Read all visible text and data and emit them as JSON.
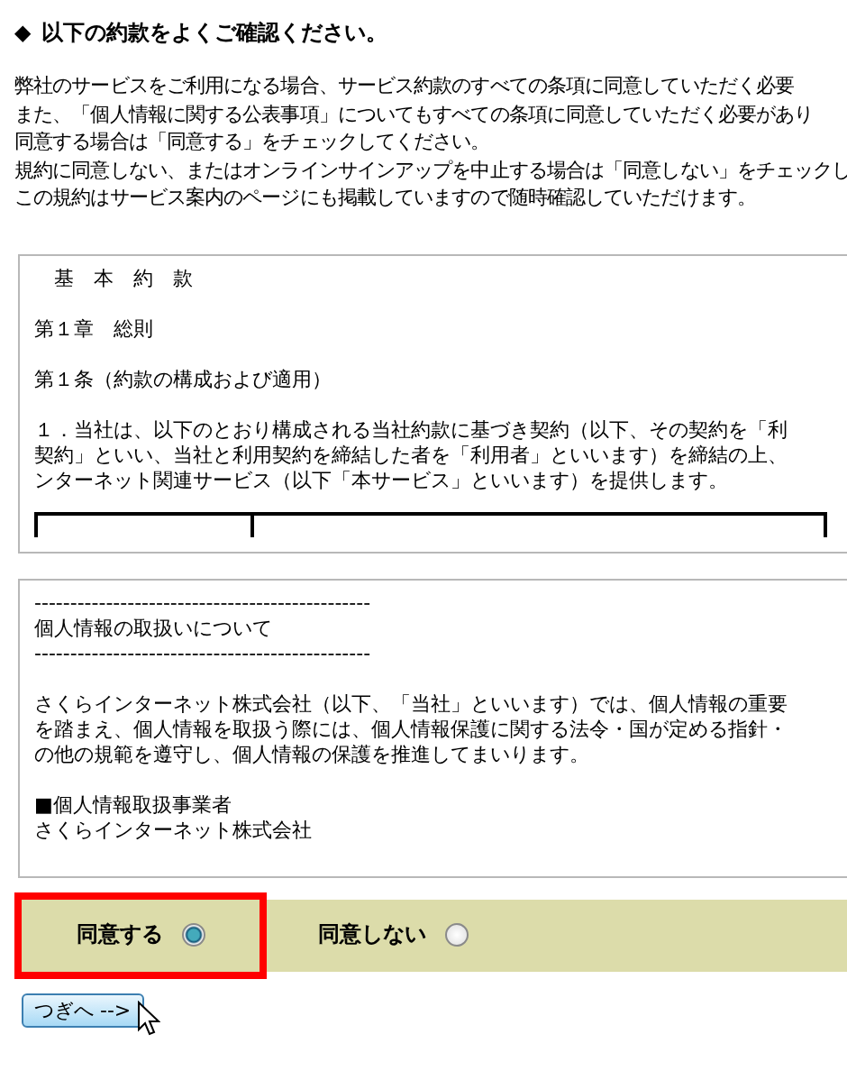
{
  "heading": {
    "marker": "◆",
    "text": "以下の約款をよくご確認ください。"
  },
  "intro": [
    "弊社のサービスをご利用になる場合、サービス約款のすべての条項に同意していただく必要",
    "また、「個人情報に関する公表事項」についてもすべての条項に同意していただく必要があり",
    "同意する場合は「同意する」をチェックしてください。",
    "規約に同意しない、またはオンラインサインアップを中止する場合は「同意しない」をチェックし",
    "この規約はサービス案内のページにも掲載していますので随時確認していただけます。"
  ],
  "documents": [
    {
      "paragraphs": [
        [
          "　基　本　約　款"
        ],
        [
          "第１章　総則"
        ],
        [
          "第１条（約款の構成および適用）"
        ],
        [
          "１．当社は、以下のとおり構成される当社約款に基づき契約（以下、その契約を「利",
          "契約」といい、当社と利用契約を締結した者を「利用者」といいます）を締結の上、",
          "ンターネット関連サービス（以下「本サービス」といいます）を提供します。"
        ]
      ],
      "table_stub": true
    },
    {
      "paragraphs": [
        [
          "-----------------------------------------------",
          "個人情報の取扱いについて",
          "-----------------------------------------------"
        ],
        [
          "さくらインターネット株式会社（以下、「当社」といいます）では、個人情報の重要",
          "を踏まえ、個人情報を取扱う際には、個人情報保護に関する法令・国が定める指針・",
          "の他の規範を遵守し、個人情報の保護を推進してまいります。"
        ],
        [
          "■個人情報取扱事業者",
          "さくらインターネット株式会社"
        ]
      ],
      "table_stub": false
    }
  ],
  "choices": [
    {
      "kind": "radio",
      "label": "同意する",
      "selected": true
    },
    {
      "kind": "radio",
      "label": "同意しない",
      "selected": false
    }
  ],
  "next_button": "つぎへ -->"
}
